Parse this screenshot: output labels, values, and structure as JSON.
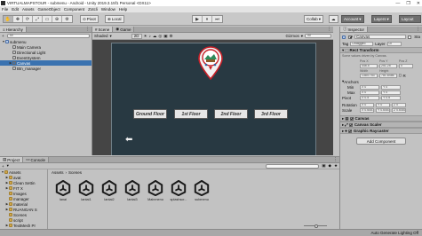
{
  "window": {
    "title": "VIRTUALMAPSTOUR - submenu - Android - Unity 2019.3.15f1 Personal <DX11>",
    "controls": [
      "—",
      "❐",
      "✕"
    ]
  },
  "menubar": [
    "File",
    "Edit",
    "Assets",
    "GameObject",
    "Component",
    "Zotcli",
    "Window",
    "Help"
  ],
  "toolbar": {
    "tools": [
      "✋",
      "✥",
      "⟳",
      "⤢",
      "▭",
      "⊕",
      "⚙"
    ],
    "pivot": "Pivot",
    "local": "Local",
    "play": "▶",
    "pause": "⏸",
    "step": "⏭",
    "collab": "Collab",
    "account": "Account",
    "layers": "Layers",
    "layout": "Layout"
  },
  "hierarchy": {
    "tab": "Hierarchy",
    "create": "+",
    "search_placeholder": "All",
    "items": [
      {
        "label": "submenu",
        "indent": 0,
        "type": "scene",
        "arrow": "▼"
      },
      {
        "label": "Main Camera",
        "indent": 1,
        "type": "obj",
        "arrow": ""
      },
      {
        "label": "Directional Light",
        "indent": 1,
        "type": "obj",
        "arrow": ""
      },
      {
        "label": "EventSystem",
        "indent": 1,
        "type": "obj",
        "arrow": ""
      },
      {
        "label": "Canvas",
        "indent": 1,
        "type": "obj",
        "arrow": "▶",
        "selected": true
      },
      {
        "label": "Btn_manager",
        "indent": 1,
        "type": "obj",
        "arrow": ""
      }
    ]
  },
  "scene": {
    "tabs": [
      "Scene",
      "Game"
    ],
    "shading": "Shaded",
    "mode": "2D",
    "gizmos": "Gizmos",
    "search": "All",
    "buttons": [
      "Ground Floor",
      "1st Floor",
      "2nd Floor",
      "3rd Floor"
    ],
    "back_glyph": "⬅"
  },
  "inspector": {
    "tab": "Inspector",
    "object_name": "Canvas",
    "static": "Sta",
    "tag_label": "Tag",
    "tag_value": "Untagged",
    "layer_label": "Layer",
    "layer_value": "UI",
    "rect_transform": "Rect Transform",
    "driven_note": "Some values driven by Canvas.",
    "pos_headers": [
      "Pos X",
      "Pos Y",
      "Pos Z"
    ],
    "pos_values": [
      "446.5",
      "251.25",
      "0"
    ],
    "size_headers": [
      "Width",
      "Height"
    ],
    "size_values": [
      "1384.753",
      "781.8486"
    ],
    "anchors": "Anchors",
    "min_label": "Min",
    "max_label": "Max",
    "min_values": [
      "X 0",
      "Y 0"
    ],
    "max_values": [
      "X 0",
      "Y 0"
    ],
    "pivot_label": "Pivot",
    "pivot_values": [
      "X 0.5",
      "Y 0.5"
    ],
    "rotation_label": "Rotation",
    "rotation_values": [
      "X 0",
      "Y 0",
      "Z 0"
    ],
    "scale_label": "Scale",
    "scale_values": [
      "X 0.6451",
      "Y 0.6451",
      "Z 0.6451"
    ],
    "components": [
      "Canvas",
      "Canvas Scaler",
      "Graphic Raycaster"
    ],
    "add_component": "Add Component"
  },
  "project": {
    "tabs": [
      "Project",
      "Console"
    ],
    "create": "+",
    "tree": [
      {
        "label": "Assets",
        "indent": 0,
        "arrow": "▼"
      },
      {
        "label": "avat",
        "indent": 1,
        "arrow": "▶"
      },
      {
        "label": "Clean Settin",
        "indent": 1,
        "arrow": "▶"
      },
      {
        "label": "FIT X",
        "indent": 1,
        "arrow": "▶"
      },
      {
        "label": "Images",
        "indent": 1,
        "arrow": ""
      },
      {
        "label": "manager",
        "indent": 1,
        "arrow": ""
      },
      {
        "label": "material",
        "indent": 1,
        "arrow": "▶"
      },
      {
        "label": "RUANGAN S",
        "indent": 1,
        "arrow": "▶"
      },
      {
        "label": "Scenes",
        "indent": 1,
        "arrow": ""
      },
      {
        "label": "script",
        "indent": 1,
        "arrow": ""
      },
      {
        "label": "TextMesh Pr",
        "indent": 1,
        "arrow": "▶"
      }
    ],
    "breadcrumb": [
      "Assets",
      "Scenes"
    ],
    "breadcrumb_sep": "›",
    "files": [
      "lanai",
      "lantai1",
      "lantai2",
      "lantai3",
      "Mainmenu",
      "splashscr...",
      "submenu"
    ]
  },
  "status": {
    "text": "Auto Generate Lighting Off"
  },
  "colors": {
    "selection": "#3a72b0",
    "panel_bg": "#c2c2c2",
    "scene_bg": "#454545",
    "canvas_bg": "#283942"
  }
}
